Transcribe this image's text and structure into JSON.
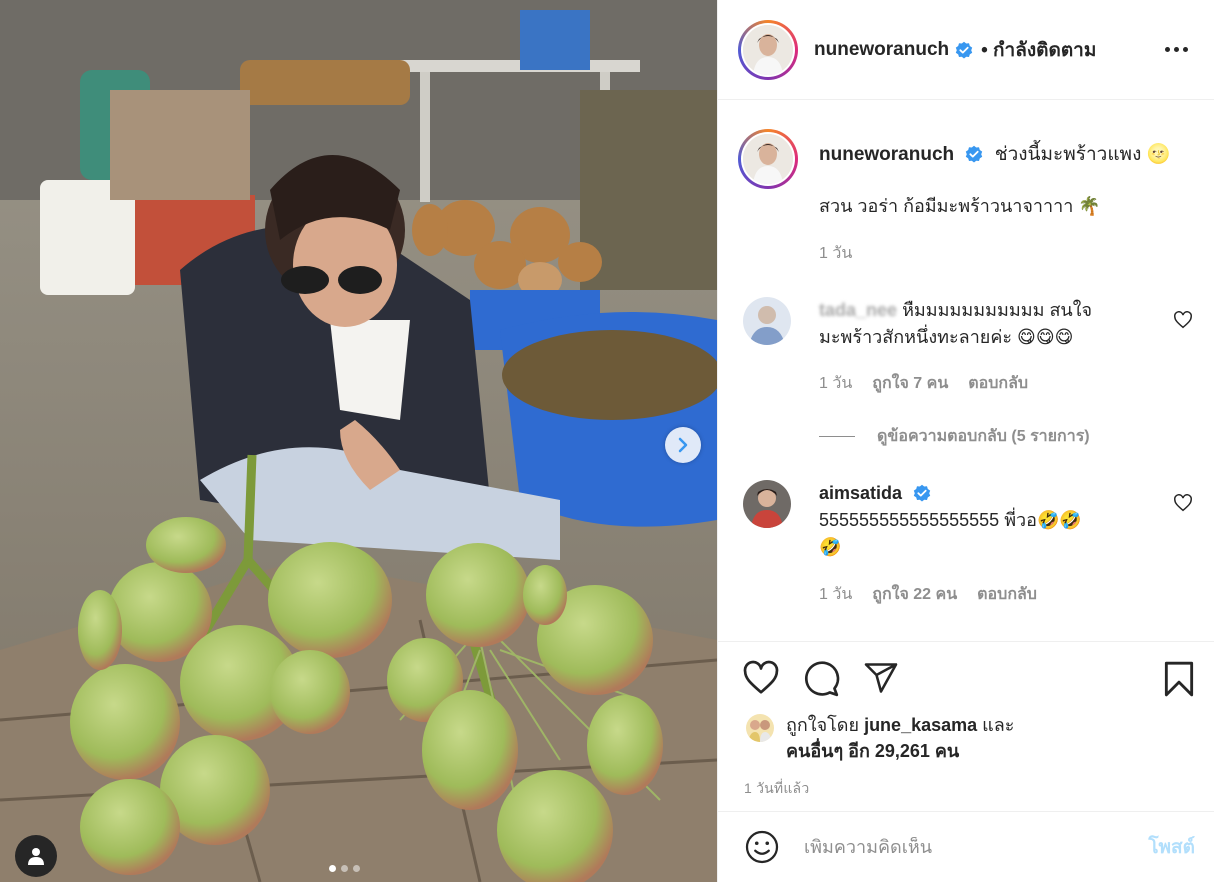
{
  "post": {
    "username": "nuneworanuch",
    "follow_status": "• กำลังติดตาม",
    "caption_line1": "ช่วงนี้มะพร้าวแพง 🌝",
    "caption_line2": "สวน วอร่า ก้อมีมะพร้าวนาจาาาา 🌴",
    "caption_time": "1 วัน",
    "carousel_index": 1,
    "carousel_count": 3
  },
  "comments": [
    {
      "username": "tada_nee",
      "text_line1": "หืมมมมมมมมมมม สนใจ",
      "text_line2": "มะพร้าวสักหนึ่งทะลายค่ะ 😋😋😋",
      "time": "1 วัน",
      "likes": "ถูกใจ 7 คน",
      "reply": "ตอบกลับ",
      "view_replies": "ดูข้อความตอบกลับ (5 รายการ)"
    },
    {
      "username": "aimsatida",
      "text_line1": "555555555555555555 พี่วอ🤣🤣",
      "text_line2": "🤣",
      "time": "1 วัน",
      "likes": "ถูกใจ 22 คน",
      "reply": "ตอบกลับ"
    }
  ],
  "likes": {
    "prefix": "ถูกใจโดย",
    "user": "june_kasama",
    "and": "และ",
    "others": "คนอื่นๆ อีก 29,261 คน"
  },
  "posted_time": "1 วันที่แล้ว",
  "add_comment": {
    "placeholder": "เพิ่มความคิดเห็น",
    "post_label": "โพสต์"
  },
  "colors": {
    "verified": "#3897f0",
    "post_disabled": "#b2dffc",
    "meta_gray": "#8e8e8e"
  },
  "icons": [
    "chevron-right-icon",
    "user-tag-icon",
    "verified-badge-icon",
    "more-icon",
    "heart-icon",
    "comment-icon",
    "share-icon",
    "bookmark-icon",
    "emoji-icon"
  ]
}
